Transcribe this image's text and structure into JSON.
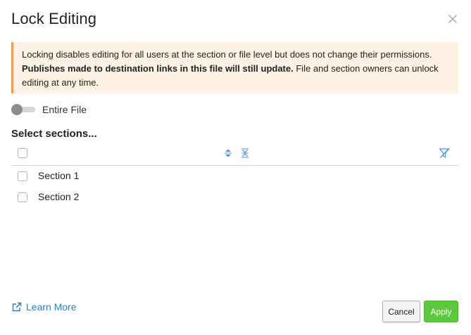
{
  "dialog": {
    "title": "Lock Editing"
  },
  "notice": {
    "text_part1": "Locking disables editing for all users at the section or file level but does not change their permissions. ",
    "text_bold": "Publishes made to destination links in this file will still update.",
    "text_part2": " File and section owners can unlock editing at any time."
  },
  "toggle": {
    "label": "Entire File",
    "checked": false
  },
  "sections": {
    "heading": "Select sections...",
    "items": [
      {
        "label": "Section 1",
        "checked": false
      },
      {
        "label": "Section 2",
        "checked": false
      }
    ]
  },
  "footer": {
    "learn_more": "Learn More",
    "cancel": "Cancel",
    "apply": "Apply"
  },
  "icons": {
    "close": "close-icon",
    "expand_all": "expand-all-icon",
    "collapse_all": "collapse-all-icon",
    "filter": "filter-off-icon",
    "external_link": "external-link-icon"
  },
  "colors": {
    "notice_bg": "#fdf2e3",
    "notice_accent": "#f29a52",
    "link": "#2a7bc0",
    "apply": "#5cc83c",
    "icon_blue": "#4a90d9"
  }
}
